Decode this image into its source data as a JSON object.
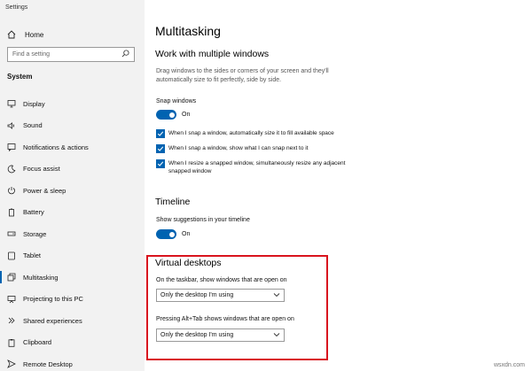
{
  "app_title": "Settings",
  "sidebar": {
    "home_label": "Home",
    "search_placeholder": "Find a setting",
    "section_label": "System",
    "items": [
      {
        "label": "Display"
      },
      {
        "label": "Sound"
      },
      {
        "label": "Notifications & actions"
      },
      {
        "label": "Focus assist"
      },
      {
        "label": "Power & sleep"
      },
      {
        "label": "Battery"
      },
      {
        "label": "Storage"
      },
      {
        "label": "Tablet"
      },
      {
        "label": "Multitasking",
        "active": true
      },
      {
        "label": "Projecting to this PC"
      },
      {
        "label": "Shared experiences"
      },
      {
        "label": "Clipboard"
      },
      {
        "label": "Remote Desktop"
      }
    ]
  },
  "main": {
    "title": "Multitasking",
    "snap": {
      "heading": "Work with multiple windows",
      "description": "Drag windows to the sides or corners of your screen and they'll automatically size to fit perfectly, side by side.",
      "toggle_label": "Snap windows",
      "toggle_state": "On",
      "options": [
        {
          "label": "When I snap a window, automatically size it to fill available space",
          "checked": true
        },
        {
          "label": "When I snap a window, show what I can snap next to it",
          "checked": true
        },
        {
          "label": "When I resize a snapped window, simultaneously resize any adjacent snapped window",
          "checked": true
        }
      ]
    },
    "timeline": {
      "heading": "Timeline",
      "toggle_label": "Show suggestions in your timeline",
      "toggle_state": "On"
    },
    "virtual_desktops": {
      "heading": "Virtual desktops",
      "taskbar_label": "On the taskbar, show windows that are open on",
      "taskbar_value": "Only the desktop I'm using",
      "alttab_label": "Pressing Alt+Tab shows windows that are open on",
      "alttab_value": "Only the desktop I'm using"
    }
  },
  "watermark": "wsxdn.com",
  "colors": {
    "accent": "#0063b1",
    "highlight_border": "#d9141e",
    "sidebar_bg": "#f2f2f2"
  }
}
